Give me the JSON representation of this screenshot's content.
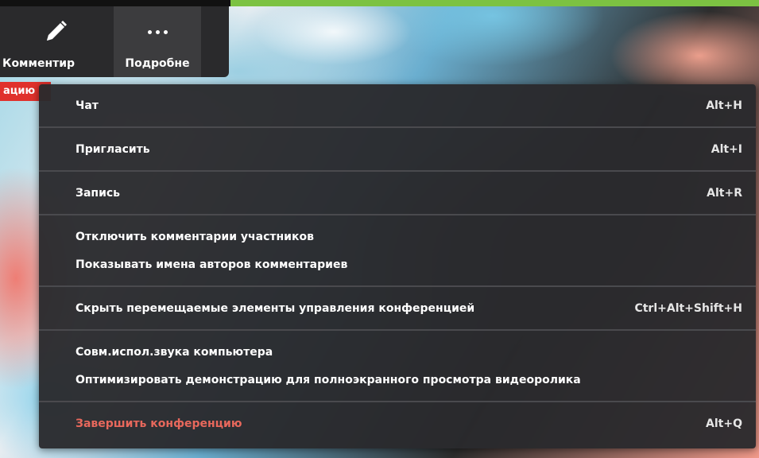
{
  "toolbar": {
    "annotate_label": "Комментир",
    "more_label": "Подробне",
    "annotate_icon": "pencil-icon",
    "more_icon": "more-dots-icon"
  },
  "tag": {
    "text": "ацию"
  },
  "menu": {
    "items": [
      {
        "label": "Чат",
        "shortcut": "Alt+H"
      },
      {
        "label": "Пригласить",
        "shortcut": "Alt+I"
      },
      {
        "label": "Запись",
        "shortcut": "Alt+R"
      },
      {
        "label": "Отключить комментарии участников",
        "shortcut": ""
      },
      {
        "label": "Показывать имена авторов комментариев",
        "shortcut": ""
      },
      {
        "label": "Скрыть перемещаемые элементы управления конференцией",
        "shortcut": "Ctrl+Alt+Shift+H"
      },
      {
        "label": "Совм.испол.звука компьютера",
        "shortcut": ""
      },
      {
        "label": "Оптимизировать демонстрацию для полноэкранного просмотра видеоролика",
        "shortcut": ""
      },
      {
        "label": "Завершить конференцию",
        "shortcut": "Alt+Q"
      }
    ]
  },
  "colors": {
    "menu_bg": "#2a2a2d",
    "danger": "#e8685c",
    "accent_strip": "#7cc242",
    "tag_bg": "#e0312c"
  }
}
